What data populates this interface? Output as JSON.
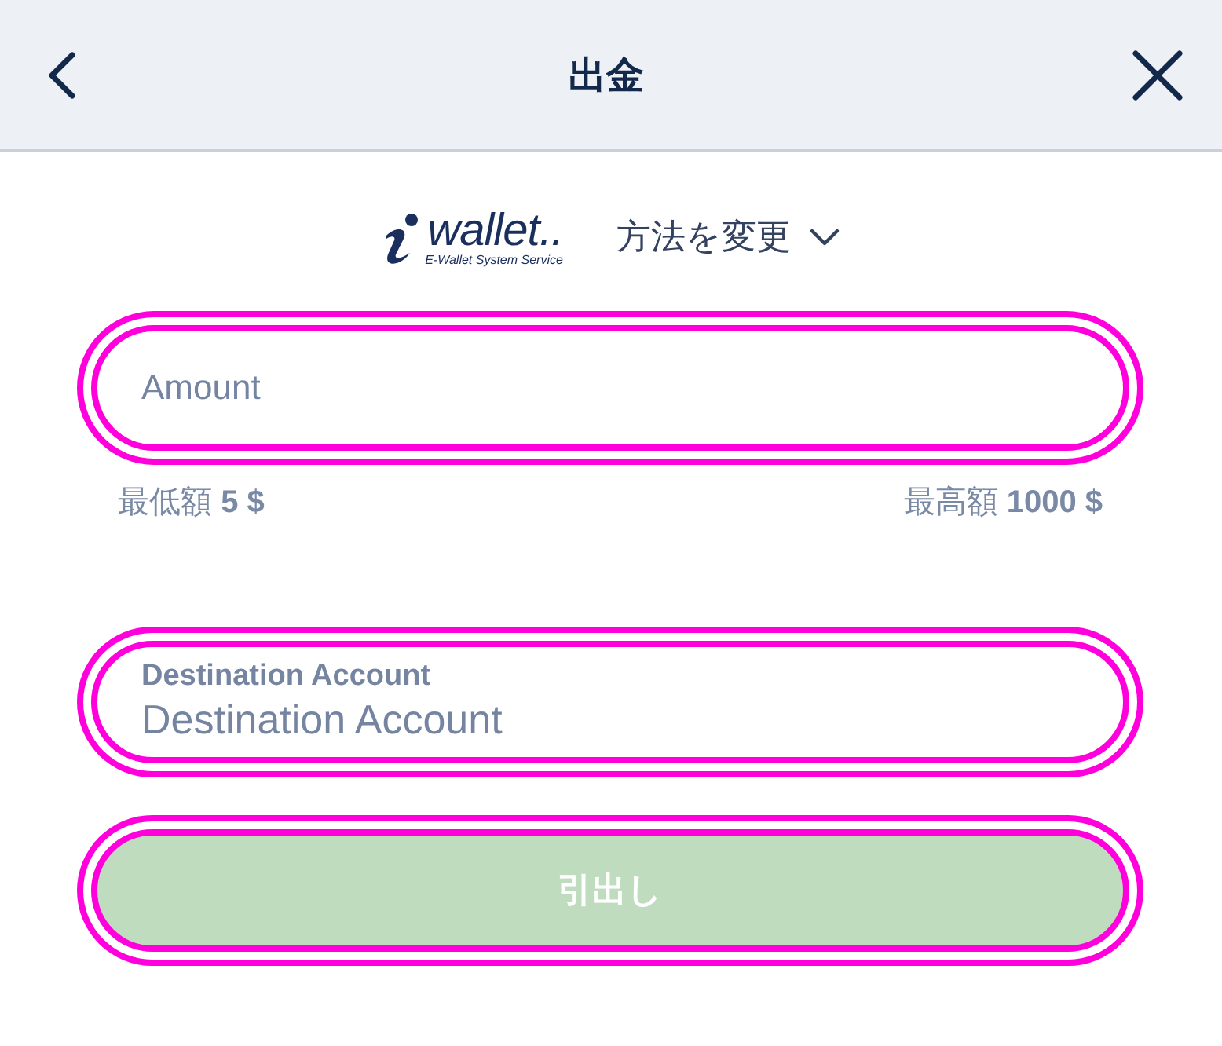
{
  "header": {
    "title": "出金"
  },
  "payment_method": {
    "logo_text": "wallet..",
    "logo_subtitle": "E-Wallet System Service",
    "change_label": "方法を変更"
  },
  "amount_field": {
    "placeholder": "Amount",
    "highlighted": true
  },
  "limits": {
    "min": "最低額 **5 $**",
    "max": "最高額 **1000 $**"
  },
  "destination_field": {
    "label": "Destination Account",
    "placeholder": "Destination Account",
    "highlighted": true
  },
  "submit_button": {
    "label": "引出し",
    "disabled": true,
    "highlighted": true
  }
}
